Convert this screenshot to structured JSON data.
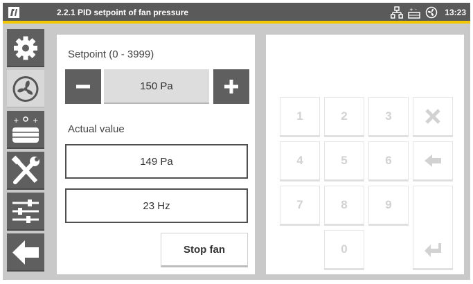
{
  "header": {
    "title": "2.2.1 PID setpoint of fan pressure",
    "time": "13:23",
    "icons": [
      "brand-logo-icon",
      "network-icon",
      "network-alt-icon",
      "fan-status-icon"
    ]
  },
  "sidebar": {
    "items": [
      {
        "icon": "gear-icon",
        "active": false
      },
      {
        "icon": "fan-icon",
        "active": true
      },
      {
        "icon": "heater-icon",
        "active": false
      },
      {
        "icon": "tools-icon",
        "active": false
      },
      {
        "icon": "sliders-icon",
        "active": false
      },
      {
        "icon": "back-arrow-icon",
        "active": false
      }
    ]
  },
  "setpoint": {
    "label": "Setpoint (0 - 3999)",
    "value": "150 Pa",
    "min": 0,
    "max": 3999
  },
  "actual": {
    "label": "Actual value",
    "pressure": "149 Pa",
    "frequency": "23 Hz"
  },
  "stop_button": {
    "label": "Stop fan"
  },
  "keypad": {
    "keys": [
      "1",
      "2",
      "3",
      "4",
      "5",
      "6",
      "7",
      "8",
      "9",
      "0"
    ],
    "clear_icon": "clear-x-icon",
    "backspace_icon": "backspace-arrow-icon",
    "enter_icon": "enter-icon"
  },
  "colors": {
    "header_bg": "#5a5a5a",
    "accent": "#f2c800",
    "sidebar_button": "#5f5f5f",
    "background": "#c9c9c9",
    "disabled_key": "#d2d2d2"
  }
}
